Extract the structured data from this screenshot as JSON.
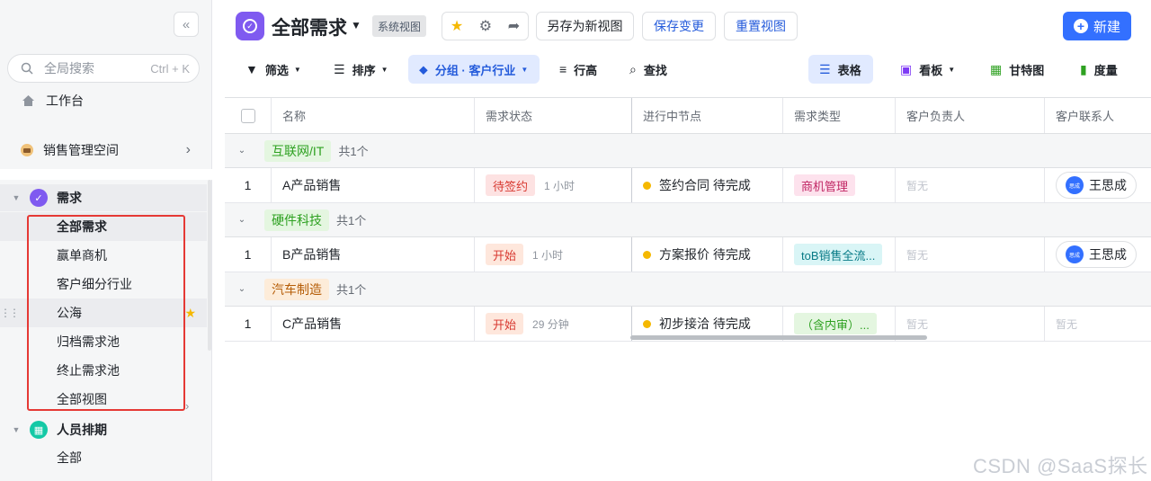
{
  "sidebar": {
    "collapse_glyph": "«",
    "search": {
      "label": "全局搜索",
      "shortcut": "Ctrl + K"
    },
    "home_label": "工作台",
    "space_label": "销售管理空间",
    "groups": [
      {
        "label": "需求",
        "icon": "check-circle-icon",
        "color": "#7f5af0",
        "items": [
          "全部需求",
          "赢单商机",
          "客户细分行业",
          "公海",
          "归档需求池",
          "终止需求池",
          "全部视图"
        ]
      },
      {
        "label": "人员排期",
        "icon": "grid-icon",
        "color": "#14c9a6",
        "items": [
          "全部"
        ]
      }
    ]
  },
  "header": {
    "title": "全部需求",
    "badge": "系统视图",
    "save_as_label": "另存为新视图",
    "save_label": "保存变更",
    "reset_label": "重置视图",
    "new_label": "新建"
  },
  "toolbar": {
    "filter": "筛选",
    "sort": "排序",
    "group": "分组 · 客户行业",
    "row_height": "行高",
    "find": "查找",
    "views": {
      "table": "表格",
      "kanban": "看板",
      "gantt": "甘特图",
      "metric": "度量"
    }
  },
  "table": {
    "columns": [
      "名称",
      "需求状态",
      "进行中节点",
      "需求类型",
      "客户负责人",
      "客户联系人"
    ],
    "groups": [
      {
        "tag": "互联网/IT",
        "tag_color": "#2ea121",
        "tag_bg": "#e4f6e0",
        "count": "共1个",
        "row": {
          "idx": "1",
          "name": "A产品销售",
          "status": "待签约",
          "status_color": "#d83931",
          "status_bg": "#fde2e2",
          "age": "1 小时",
          "node": "签约合同 待完成",
          "type": "商机管理",
          "type_color": "#c02563",
          "type_bg": "#fde2ed",
          "owner": "暂无",
          "contact": "王思成",
          "avatar": "思成"
        }
      },
      {
        "tag": "硬件科技",
        "tag_color": "#2ea121",
        "tag_bg": "#e4f6e0",
        "count": "共1个",
        "row": {
          "idx": "1",
          "name": "B产品销售",
          "status": "开始",
          "status_color": "#d83931",
          "status_bg": "#fee7dc",
          "age": "1 小时",
          "node": "方案报价 待完成",
          "type": "toB销售全流...",
          "type_color": "#077a86",
          "type_bg": "#d9f5f6",
          "owner": "暂无",
          "contact": "王思成",
          "avatar": "思成"
        }
      },
      {
        "tag": "汽车制造",
        "tag_color": "#b55d07",
        "tag_bg": "#fdecd9",
        "count": "共1个",
        "row": {
          "idx": "1",
          "name": "C产品销售",
          "status": "开始",
          "status_color": "#d83931",
          "status_bg": "#fee7dc",
          "age": "29 分钟",
          "node": "初步接洽 待完成",
          "type": "（含内审）...",
          "type_color": "#2ea121",
          "type_bg": "#e4f6e0",
          "owner": "暂无",
          "contact": "暂无"
        }
      }
    ]
  },
  "watermark": "CSDN @SaaS探长"
}
